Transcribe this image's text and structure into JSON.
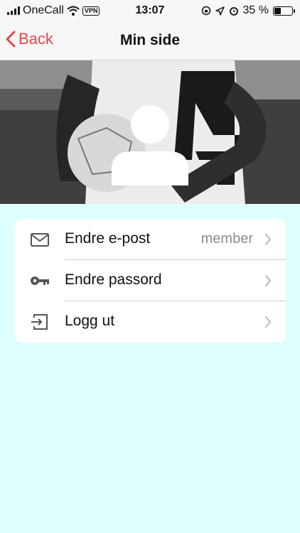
{
  "status_bar": {
    "carrier": "OneCall",
    "vpn": "VPN",
    "time": "13:07",
    "battery": "35 %"
  },
  "nav": {
    "back_label": "Back",
    "title": "Min side"
  },
  "menu": {
    "items": [
      {
        "label": "Endre e-post",
        "value": "member",
        "icon": "envelope-icon"
      },
      {
        "label": "Endre passord",
        "value": "",
        "icon": "key-icon"
      },
      {
        "label": "Logg ut",
        "value": "",
        "icon": "logout-icon"
      }
    ]
  },
  "colors": {
    "accent": "#e5484d",
    "background": "#dfffff"
  }
}
